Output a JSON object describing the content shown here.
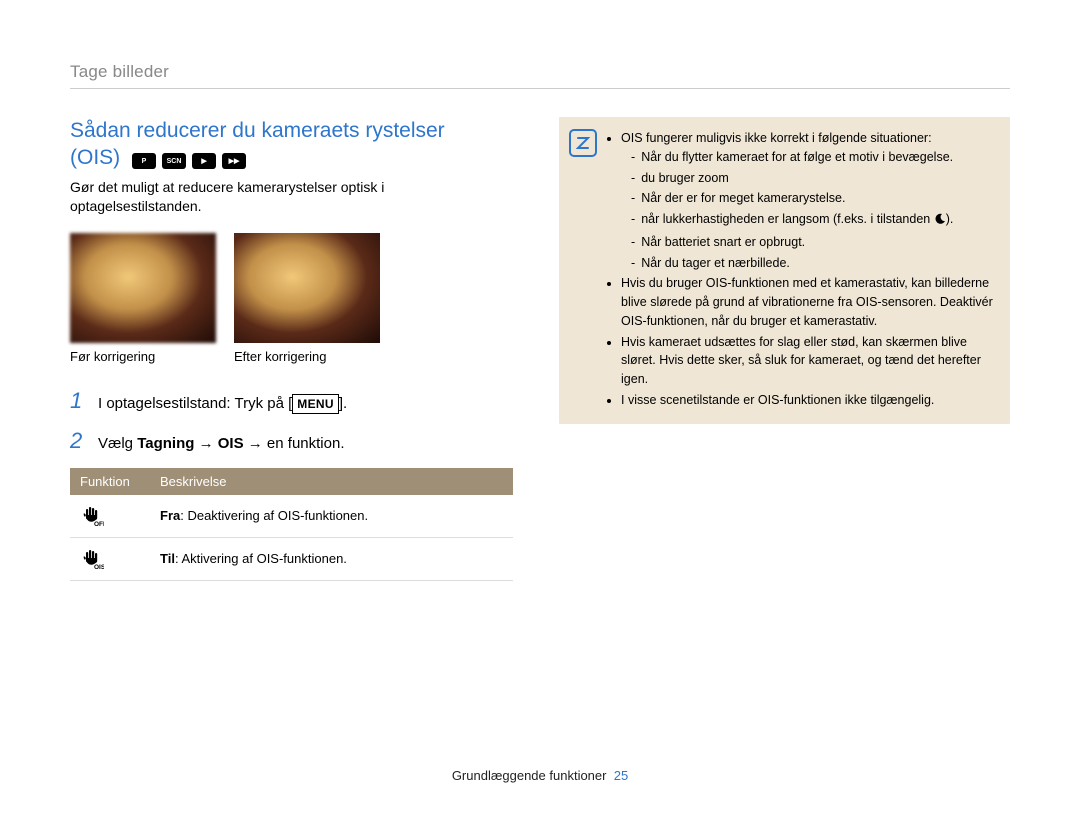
{
  "section_label": "Tage billeder",
  "heading_line1": "Sådan reducerer du kameraets rystelser",
  "heading_line2": "(OIS)",
  "mode_icons": [
    "program-mode-icon",
    "scene-mode-icon",
    "movie-mode-icon",
    "smart-movie-mode-icon"
  ],
  "lead": "Gør det muligt at reducere kamerarystelser optisk i optagelsestilstanden.",
  "thumbs": {
    "before_caption": "Før korrigering",
    "after_caption": "Efter korrigering"
  },
  "steps": {
    "one": {
      "num": "1",
      "text_before": "I optagelsestilstand: Tryk på [",
      "menu_label": "MENU",
      "text_after": "]."
    },
    "two": {
      "num": "2",
      "prefix": "Vælg ",
      "strong": "Tagning",
      "mid1": " → ",
      "strong2": "OIS",
      "mid2": " → en funktion."
    }
  },
  "table": {
    "head_function": "Funktion",
    "head_desc": "Beskrivelse",
    "rows": [
      {
        "icon": "ois-off-icon",
        "label": "Fra",
        "desc": ": Deaktivering af OIS-funktionen."
      },
      {
        "icon": "ois-on-icon",
        "label": "Til",
        "desc": ": Aktivering af OIS-funktionen."
      }
    ]
  },
  "note": {
    "bullets": [
      {
        "text": "OIS fungerer muligvis ikke korrekt i følgende situationer:",
        "sub": [
          "Når du flytter kameraet for at følge et motiv i bevægelse.",
          "du bruger zoom",
          "Når der er for meget kamerarystelse.",
          "når lukkerhastigheden er langsom (f.eks. i tilstanden __MOON__).",
          "Når batteriet snart er opbrugt.",
          "Når du tager et nærbillede."
        ]
      },
      {
        "text": "Hvis du bruger OIS-funktionen med et kamerastativ, kan billederne blive slørede på grund af vibrationerne fra OIS-sensoren. Deaktivér OIS-funktionen, når du bruger et kamerastativ."
      },
      {
        "text": "Hvis kameraet udsættes for slag eller stød, kan skærmen blive sløret. Hvis dette sker, så sluk for kameraet, og tænd det herefter igen."
      },
      {
        "text": "I visse scenetilstande er OIS-funktionen ikke tilgængelig."
      }
    ]
  },
  "footer": {
    "label": "Grundlæggende funktioner",
    "page": "25"
  }
}
